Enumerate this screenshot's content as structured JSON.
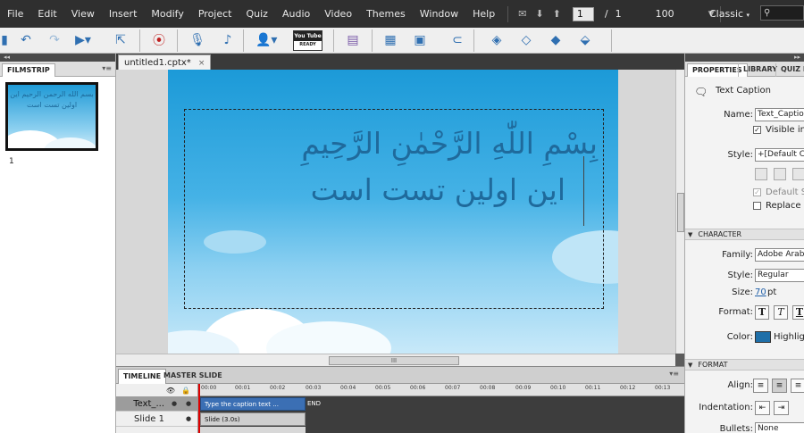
{
  "menubar": {
    "items": [
      "File",
      "Edit",
      "View",
      "Insert",
      "Modify",
      "Project",
      "Quiz",
      "Audio",
      "Video",
      "Themes",
      "Window",
      "Help"
    ],
    "current_slide": "1",
    "slide_separator": "/",
    "total_slides": "1",
    "zoom": "100",
    "mode": "Classic",
    "search_placeholder": ""
  },
  "toolbar": {
    "youtube_top": "You Tube",
    "youtube_bottom": "READY"
  },
  "filmstrip": {
    "tab": "FILMSTRIP",
    "slide_number": "1",
    "thumb_text": "بسم الله الرحمن الرحيم این اولین تست است"
  },
  "document": {
    "tab_label": "untitled1.cptx*",
    "close": "×"
  },
  "slide": {
    "caption_line1": "بِسْمِ اللّٰهِ الرَّحْمٰنِ الرَّحِيمِ",
    "caption_line2": "این اولین تست است",
    "hscroll_grip": "III"
  },
  "timeline": {
    "tab_timeline": "TIMELINE",
    "tab_master": "MASTER SLIDE",
    "layers": [
      {
        "name": "Text_..."
      },
      {
        "name": "Slide 1"
      }
    ],
    "ticks": [
      "00:00",
      "00:01",
      "00:02",
      "00:03",
      "00:04",
      "00:05",
      "00:06",
      "00:07",
      "00:08",
      "00:09",
      "00:10",
      "00:11",
      "00:12",
      "00:13"
    ],
    "bar_caption": "Type the caption text ...",
    "bar_end": "END",
    "bar_slide": "Slide (3.0s)"
  },
  "properties": {
    "tab_properties": "PROPERTIES",
    "tab_library": "LIBRARY",
    "tab_quiz": "QUIZ P",
    "object_type": "Text Caption",
    "name_label": "Name:",
    "name_value": "Text_Caption",
    "visible_label": "Visible in o",
    "style_label": "Style:",
    "style_value": "+[Default C",
    "default_style_label": "Default St",
    "replace_label": "Replace m",
    "section_character": "CHARACTER",
    "family_label": "Family:",
    "family_value": "Adobe Arabi",
    "font_style_label": "Style:",
    "font_style_value": "Regular",
    "size_label": "Size:",
    "size_value": "70",
    "size_unit": "pt",
    "format_label": "Format:",
    "format_bold": "T",
    "format_italic": "T",
    "format_underline": "T",
    "color_label": "Color:",
    "highlight_label": "Highlig",
    "text_color": "#1f6fa8",
    "section_format": "FORMAT",
    "align_label": "Align:",
    "indentation_label": "Indentation:",
    "bullets_label": "Bullets:",
    "bullets_value": "None"
  }
}
